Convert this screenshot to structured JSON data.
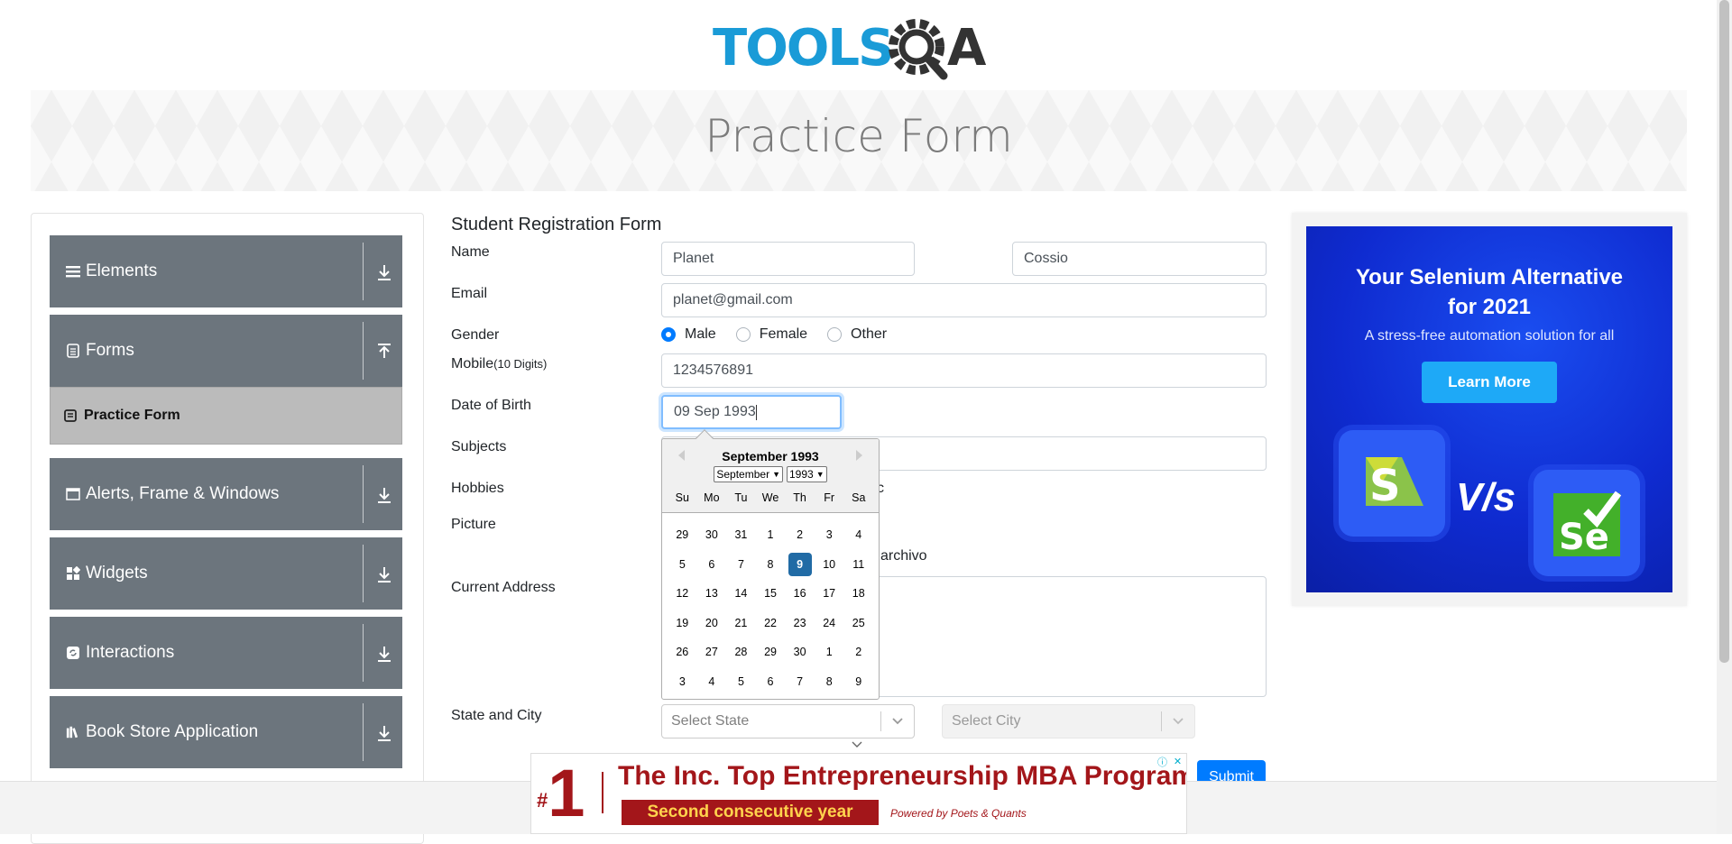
{
  "header": {
    "logo_text": "TOOLSQA",
    "page_title": "Practice Form"
  },
  "sidebar": {
    "groups": [
      {
        "label": "Elements"
      },
      {
        "label": "Forms"
      },
      {
        "label": "Alerts, Frame & Windows"
      },
      {
        "label": "Widgets"
      },
      {
        "label": "Interactions"
      },
      {
        "label": "Book Store Application"
      }
    ],
    "active_item": "Practice Form"
  },
  "form": {
    "title": "Student Registration Form",
    "labels": {
      "name": "Name",
      "email": "Email",
      "gender": "Gender",
      "mobile": "Mobile",
      "mobile_hint": "(10 Digits)",
      "dob": "Date of Birth",
      "subjects": "Subjects",
      "hobbies": "Hobbies",
      "picture": "Picture",
      "address": "Current Address",
      "state_city": "State and City"
    },
    "first_name": "Planet",
    "last_name": "Cossio",
    "email": "planet@gmail.com",
    "gender_options": [
      "Male",
      "Female",
      "Other"
    ],
    "gender_selected": "Male",
    "mobile": "1234576891",
    "dob": "09 Sep 1993",
    "hobbies_partial": "c",
    "picture_partial": "archivo",
    "state_placeholder": "Select State",
    "city_placeholder": "Select City",
    "submit_label": "Submit"
  },
  "datepicker": {
    "month_title": "September 1993",
    "month_select": "September",
    "year_select": "1993",
    "weekdays": [
      "Su",
      "Mo",
      "Tu",
      "We",
      "Th",
      "Fr",
      "Sa"
    ],
    "weeks": [
      [
        "29",
        "30",
        "31",
        "1",
        "2",
        "3",
        "4"
      ],
      [
        "5",
        "6",
        "7",
        "8",
        "9",
        "10",
        "11"
      ],
      [
        "12",
        "13",
        "14",
        "15",
        "16",
        "17",
        "18"
      ],
      [
        "19",
        "20",
        "21",
        "22",
        "23",
        "24",
        "25"
      ],
      [
        "26",
        "27",
        "28",
        "29",
        "30",
        "1",
        "2"
      ],
      [
        "3",
        "4",
        "5",
        "6",
        "7",
        "8",
        "9"
      ]
    ],
    "selected_day": "9"
  },
  "side_ad": {
    "title_line1": "Your Selenium Alternative",
    "title_line2": "for 2021",
    "subtitle": "A stress-free automation solution for all",
    "button": "Learn More",
    "vs_text": "V/s",
    "left_logo": "S",
    "right_logo": "Se"
  },
  "bottom_ad": {
    "number": "1",
    "hash": "#",
    "headline": "The Inc. Top Entrepreneurship MBA Program",
    "tagline": "Second consecutive year",
    "powered": "Powered by Poets & Quants"
  },
  "colors": {
    "menu_bg": "#6c757d",
    "primary": "#007bff",
    "ad_blue": "#0f2bd0",
    "ad_red": "#a3161a",
    "selected_day": "#216ba5"
  }
}
